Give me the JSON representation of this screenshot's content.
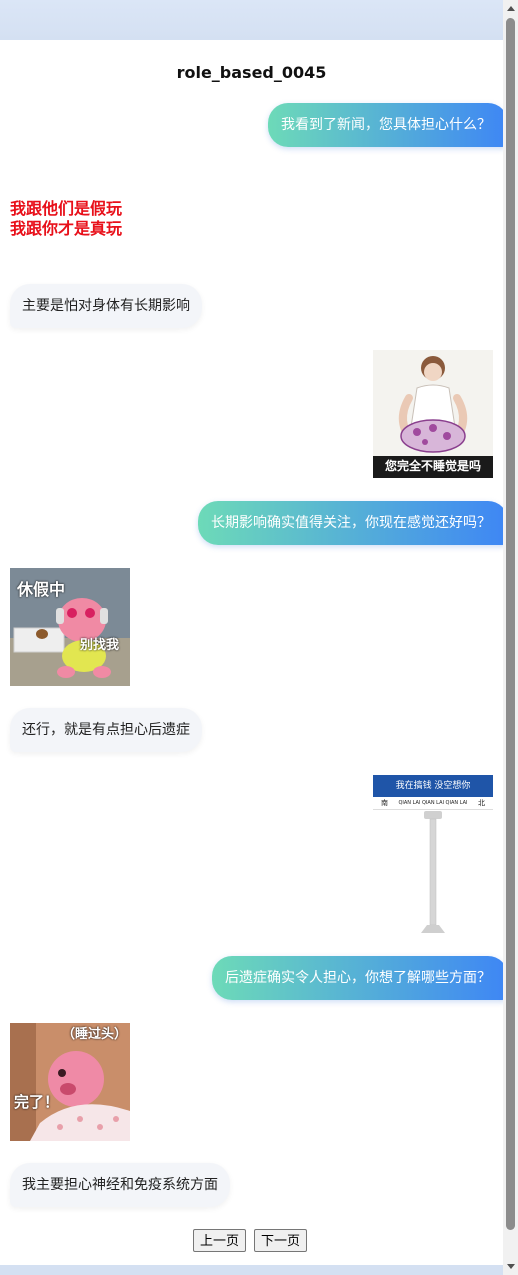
{
  "chat": {
    "title": "role_based_0045",
    "messages": [
      {
        "role": "assistant",
        "text": "我看到了新闻，您具体担心什么？"
      },
      {
        "role": "user",
        "sticker": "red-text-meme",
        "caption_lines": [
          "我跟他们是假玩",
          "我跟你才是真玩"
        ]
      },
      {
        "role": "user",
        "text": "主要是怕对身体有长期影响"
      },
      {
        "role": "assistant",
        "sticker": "man-holding-pillow-meme",
        "caption": "您完全不睡觉是吗"
      },
      {
        "role": "assistant",
        "text": "长期影响确实值得关注，你现在感觉还好吗？"
      },
      {
        "role": "user",
        "sticker": "pink-beaver-vacation-meme",
        "caption_top": "休假中",
        "caption_bottom": "别找我"
      },
      {
        "role": "user",
        "text": "还行，就是有点担心后遗症"
      },
      {
        "role": "assistant",
        "sticker": "street-sign-meme",
        "sign_top": "我在搞钱 没空想你",
        "sign_left": "南",
        "sign_middle": "QIAN LAI QIAN LAI QIAN LAI",
        "sign_right": "北"
      },
      {
        "role": "assistant",
        "text": "后遗症确实令人担心，你想了解哪些方面？"
      },
      {
        "role": "user",
        "sticker": "pink-beaver-overslept-meme",
        "caption_top": "（睡过头）",
        "caption_bottom": "完了！"
      },
      {
        "role": "user",
        "text": "我主要担心神经和免疫系统方面"
      }
    ]
  },
  "pagination": {
    "prev_label": "上一页",
    "next_label": "下一页"
  },
  "colors": {
    "bubble_gradient_start": "#6ddab8",
    "bubble_gradient_end": "#3e86f5",
    "left_bubble": "#f3f5f9",
    "meme_red": "#e8101a"
  }
}
